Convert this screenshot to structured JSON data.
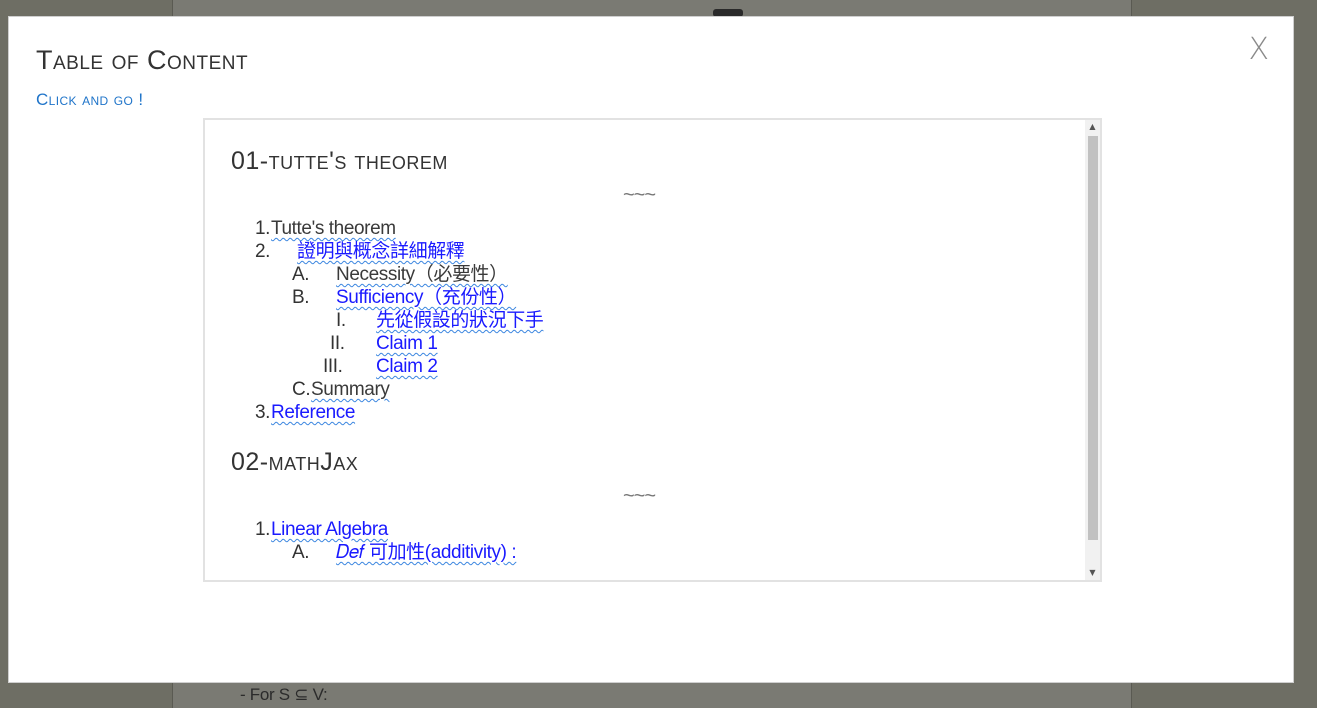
{
  "background": {
    "bottom_text": "- For S ⊆ V:"
  },
  "modal": {
    "title": "Table of Content",
    "subtitle": "Click and go !",
    "close_label": "X"
  },
  "toc": {
    "sections": [
      {
        "title": "01-tutte's theorem",
        "divider": "~~~",
        "items": [
          {
            "num": "1.",
            "label": "Tutte's theorem",
            "style": "gray"
          },
          {
            "num": "2.",
            "label": "證明與概念詳細解釋",
            "style": "blue"
          },
          {
            "num": "A.",
            "label": "Necessity（必要性）",
            "style": "gray"
          },
          {
            "num": "B.",
            "label": "Sufficiency（充份性）",
            "style": "blue"
          },
          {
            "num": "I.",
            "label": "先從假設的狀況下手",
            "style": "blue"
          },
          {
            "num": "II.",
            "label": "Claim 1",
            "style": "blue"
          },
          {
            "num": "III.",
            "label": "Claim 2",
            "style": "blue"
          },
          {
            "num": "C.",
            "label": "Summary",
            "style": "gray"
          },
          {
            "num": "3.",
            "label": "Reference",
            "style": "blue"
          }
        ]
      },
      {
        "title": "02-mathJax",
        "divider": "~~~",
        "items": [
          {
            "num": "1.",
            "label": "Linear Algebra",
            "style": "blue"
          },
          {
            "num": "A.",
            "label": "𝐷𝑒𝑓 可加性(additivity) :",
            "style": "blue"
          }
        ]
      }
    ]
  },
  "colors": {
    "link_blue": "#1a1aff",
    "subtitle_blue": "#1f74c9",
    "overlay": "#6e6e64"
  }
}
